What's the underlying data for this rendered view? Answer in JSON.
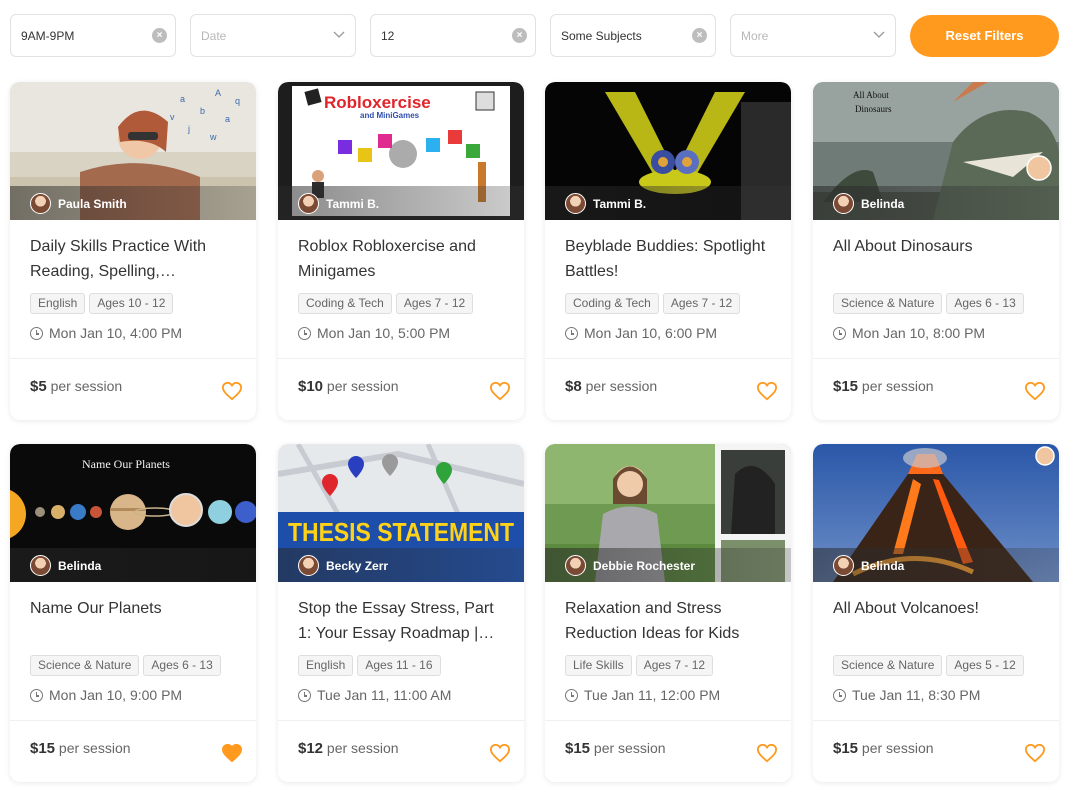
{
  "filters": {
    "time": "9AM-9PM",
    "date_placeholder": "Date",
    "age": "12",
    "subjects": "Some Subjects",
    "more_placeholder": "More",
    "reset_label": "Reset Filters"
  },
  "price_suffix": "per session",
  "accent": "#ff9a1f",
  "cards": [
    {
      "teacher": "Paula Smith",
      "title": "Daily Skills Practice With Reading, Spelling,…",
      "tags": [
        "English",
        "Ages 10 - 12"
      ],
      "time": "Mon Jan 10, 4:00 PM",
      "price": "$5",
      "favorited": false
    },
    {
      "teacher": "Tammi B.",
      "title": "Roblox Robloxercise and Minigames",
      "tags": [
        "Coding & Tech",
        "Ages 7 - 12"
      ],
      "time": "Mon Jan 10, 5:00 PM",
      "price": "$10",
      "favorited": false,
      "image_text": "Robloxercise",
      "image_subtext": "and MiniGames"
    },
    {
      "teacher": "Tammi B.",
      "title": "Beyblade Buddies: Spotlight Battles!",
      "tags": [
        "Coding & Tech",
        "Ages 7 - 12"
      ],
      "time": "Mon Jan 10, 6:00 PM",
      "price": "$8",
      "favorited": false
    },
    {
      "teacher": "Belinda",
      "title": "All About Dinosaurs",
      "tags": [
        "Science & Nature",
        "Ages 6 - 13"
      ],
      "time": "Mon Jan 10, 8:00 PM",
      "price": "$15",
      "favorited": false,
      "image_text": "All About",
      "image_subtext": "Dinosaurs"
    },
    {
      "teacher": "Belinda",
      "title": "Name Our Planets",
      "tags": [
        "Science & Nature",
        "Ages 6 - 13"
      ],
      "time": "Mon Jan 10, 9:00 PM",
      "price": "$15",
      "favorited": true,
      "image_text": "Name Our Planets"
    },
    {
      "teacher": "Becky Zerr",
      "title": "Stop the Essay Stress, Part 1: Your Essay Roadmap |…",
      "tags": [
        "English",
        "Ages 11 - 16"
      ],
      "time": "Tue Jan 11, 11:00 AM",
      "price": "$12",
      "favorited": false,
      "image_text": "THESIS STATEMENT"
    },
    {
      "teacher": "Debbie Rochester",
      "title": "Relaxation and Stress Reduction Ideas for Kids",
      "tags": [
        "Life Skills",
        "Ages 7 - 12"
      ],
      "time": "Tue Jan 11, 12:00 PM",
      "price": "$15",
      "favorited": false
    },
    {
      "teacher": "Belinda",
      "title": "All About Volcanoes!",
      "tags": [
        "Science & Nature",
        "Ages 5 - 12"
      ],
      "time": "Tue Jan 11, 8:30 PM",
      "price": "$15",
      "favorited": false
    }
  ]
}
